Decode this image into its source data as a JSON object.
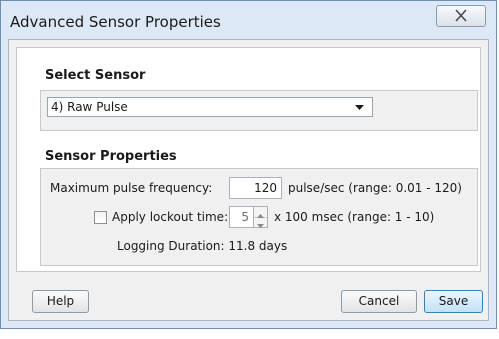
{
  "window": {
    "title": "Advanced Sensor Properties"
  },
  "select_sensor": {
    "heading": "Select Sensor",
    "selected": "4) Raw Pulse"
  },
  "sensor_properties": {
    "heading": "Sensor Properties",
    "max_freq": {
      "label": "Maximum pulse frequency:",
      "value": "120",
      "units": "pulse/sec (range: 0.01 - 120)"
    },
    "lockout": {
      "label": "Apply lockout time:",
      "checked": false,
      "value": "5",
      "units": "x 100 msec (range: 1 - 10)"
    },
    "logging_duration": "Logging Duration: 11.8 days"
  },
  "buttons": {
    "help": "Help",
    "cancel": "Cancel",
    "save": "Save"
  },
  "colors": {
    "primary_button": "#c2e2f7",
    "dialog_frame": "#dfe9f5"
  }
}
